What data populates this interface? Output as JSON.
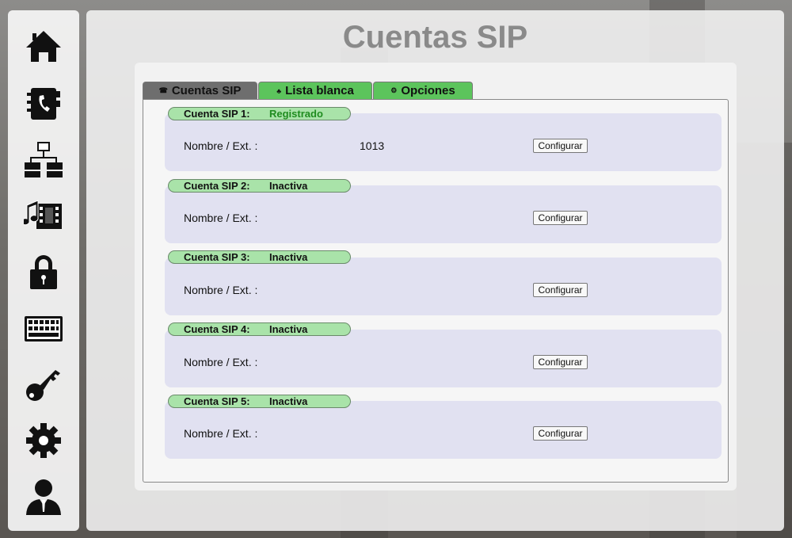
{
  "page": {
    "title": "Cuentas SIP"
  },
  "sidebar": {
    "items": [
      {
        "icon": "home-icon"
      },
      {
        "icon": "phonebook-icon"
      },
      {
        "icon": "network-icon"
      },
      {
        "icon": "multimedia-icon"
      },
      {
        "icon": "lock-icon"
      },
      {
        "icon": "keyboard-icon"
      },
      {
        "icon": "key-icon"
      },
      {
        "icon": "gear-icon"
      },
      {
        "icon": "user-icon"
      }
    ]
  },
  "tabs": [
    {
      "label": "Cuentas SIP",
      "active": true
    },
    {
      "label": "Lista blanca",
      "active": false
    },
    {
      "label": "Opciones",
      "active": false
    }
  ],
  "accounts": [
    {
      "label": "Cuenta SIP 1:",
      "status": "Registrado",
      "field_label": "Nombre / Ext. :",
      "value": "1013",
      "button": "Configurar"
    },
    {
      "label": "Cuenta SIP 2:",
      "status": "Inactiva",
      "field_label": "Nombre / Ext. :",
      "value": "",
      "button": "Configurar"
    },
    {
      "label": "Cuenta SIP 3:",
      "status": "Inactiva",
      "field_label": "Nombre / Ext. :",
      "value": "",
      "button": "Configurar"
    },
    {
      "label": "Cuenta SIP 4:",
      "status": "Inactiva",
      "field_label": "Nombre / Ext. :",
      "value": "",
      "button": "Configurar"
    },
    {
      "label": "Cuenta SIP 5:",
      "status": "Inactiva",
      "field_label": "Nombre / Ext. :",
      "value": "",
      "button": "Configurar"
    }
  ],
  "colors": {
    "status_ok": "#1f8c1f",
    "tab_active": "#6e6e6e",
    "tab_inactive": "#5cc45c",
    "header_pill": "#a9e3a9"
  }
}
